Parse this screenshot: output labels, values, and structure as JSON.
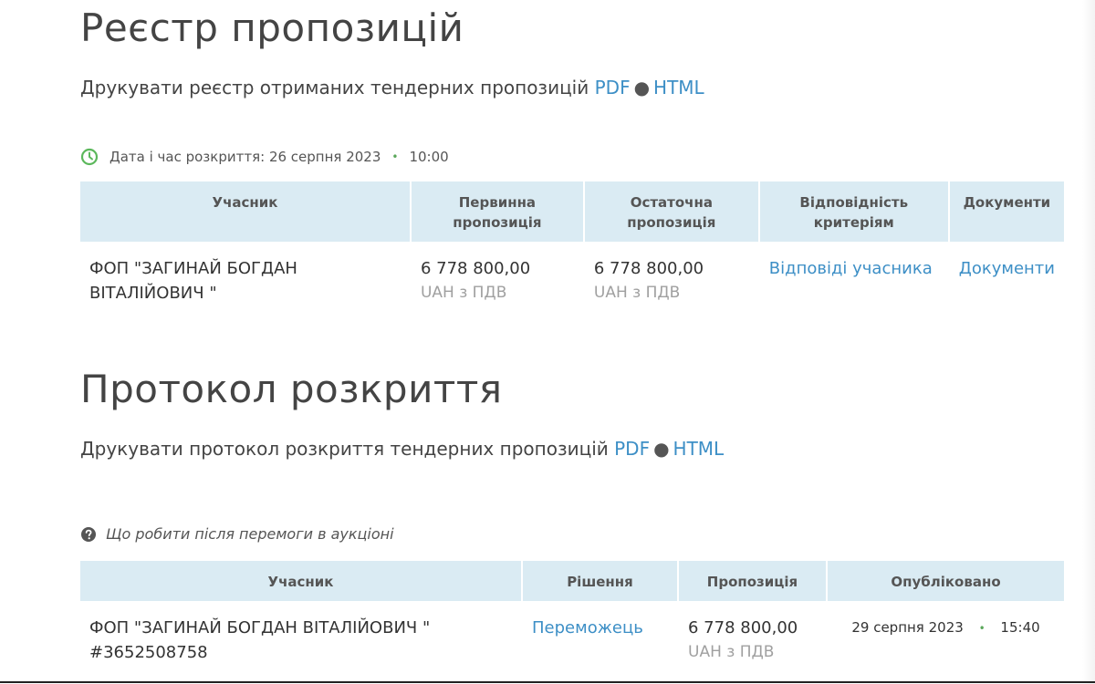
{
  "registry": {
    "title": "Реєстр пропозицій",
    "print_text": "Друкувати реєстр отриманих тендерних пропозицій",
    "pdf_label": "PDF",
    "html_label": "HTML",
    "separator": "●",
    "opening_label": "Дата і час розкриття: 26 серпня 2023",
    "opening_time": "10:00",
    "headers": {
      "participant": "Учасник",
      "initial": "Первинна пропозиція",
      "final": "Остаточна пропозиція",
      "criteria": "Відповідність критеріям",
      "documents": "Документи"
    },
    "rows": [
      {
        "participant": "ФОП \"ЗАГИНАЙ БОГДАН ВІТАЛІЙОВИЧ \"",
        "initial_amount": "6 778 800,00",
        "initial_currency": "UAH з ПДВ",
        "final_amount": "6 778 800,00",
        "final_currency": "UAH з ПДВ",
        "criteria_link": "Відповіді учасника",
        "documents_link": "Документи"
      }
    ]
  },
  "protocol": {
    "title": "Протокол розкриття",
    "print_text": "Друкувати протокол розкриття тендерних пропозицій",
    "pdf_label": "PDF",
    "html_label": "HTML",
    "separator": "●",
    "help_text": "Що робити після перемоги в аукціоні",
    "headers": {
      "participant": "Учасник",
      "decision": "Рішення",
      "offer": "Пропозиція",
      "published": "Опубліковано"
    },
    "rows": [
      {
        "participant": "ФОП \"ЗАГИНАЙ БОГДАН ВІТАЛІЙОВИЧ \"",
        "participant_id": "#3652508758",
        "decision_link": "Переможець",
        "offer_amount": "6 778 800,00",
        "offer_currency": "UAH з ПДВ",
        "published_date": "29 серпня 2023",
        "published_time": "15:40"
      }
    ]
  },
  "colors": {
    "link": "#3d8fc6",
    "table_header_bg": "#daebf3",
    "clock_icon": "#5cb85c",
    "muted_text": "#a0a0a0"
  }
}
